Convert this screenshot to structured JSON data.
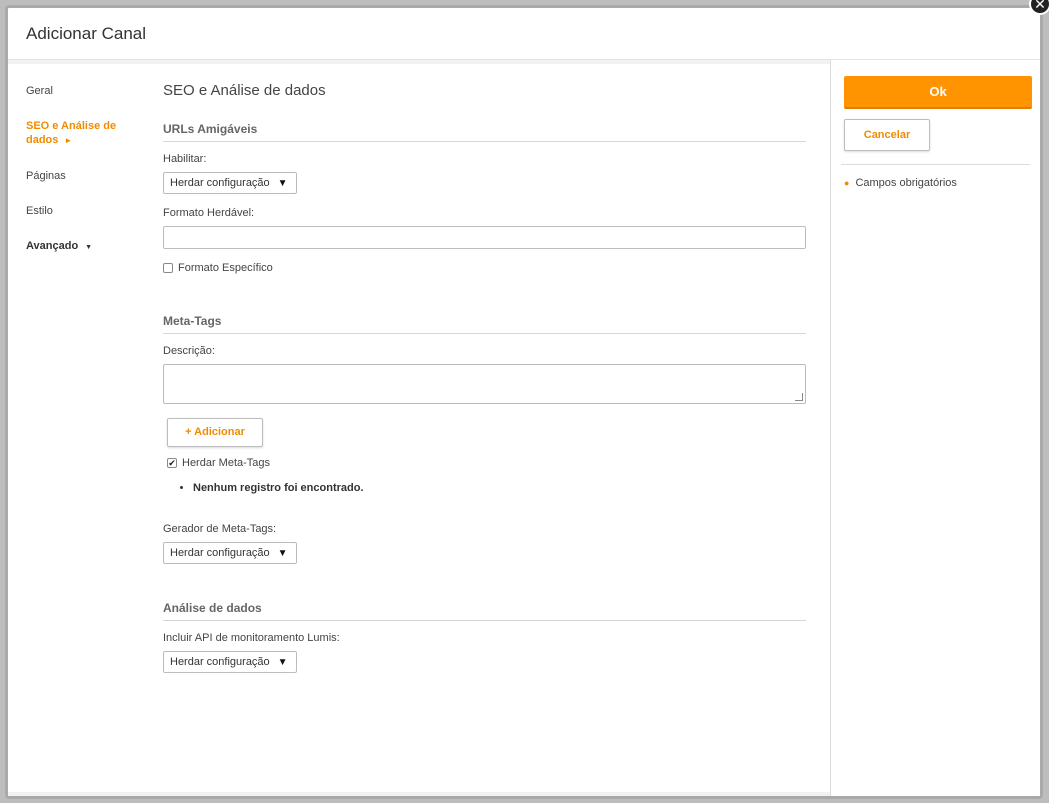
{
  "dialog": {
    "title": "Adicionar Canal",
    "close_glyph": "✕"
  },
  "nav": {
    "items": [
      {
        "label": "Geral"
      },
      {
        "label": "SEO e Análise de dados",
        "arrow": "►"
      },
      {
        "label": "Páginas"
      },
      {
        "label": "Estilo"
      },
      {
        "label": "Avançado",
        "caret": "▼"
      }
    ]
  },
  "content": {
    "title": "SEO e Análise de dados",
    "urls": {
      "heading": "URLs Amigáveis",
      "enable_label": "Habilitar:",
      "enable_value": "Herdar configuração",
      "format_label": "Formato Herdável:",
      "format_value": "",
      "specific_label": "Formato Específico",
      "specific_checked": false
    },
    "meta": {
      "heading": "Meta-Tags",
      "desc_label": "Descrição:",
      "desc_value": "",
      "add_button": "+ Adicionar",
      "inherit_label": "Herdar Meta-Tags",
      "inherit_checked": true,
      "empty_message": "Nenhum registro foi encontrado.",
      "generator_label": "Gerador de Meta-Tags:",
      "generator_value": "Herdar configuração"
    },
    "analytics": {
      "heading": "Análise de dados",
      "api_label": "Incluir API de monitoramento Lumis:",
      "api_value": "Herdar configuração"
    },
    "select_arrow": "▼",
    "check_mark": "✔"
  },
  "side": {
    "ok_label": "Ok",
    "cancel_label": "Cancelar",
    "required_note": "Campos obrigatórios",
    "required_bullet": "●"
  },
  "colors": {
    "accent": "#ff9400",
    "accent_text": "#f08c00"
  }
}
